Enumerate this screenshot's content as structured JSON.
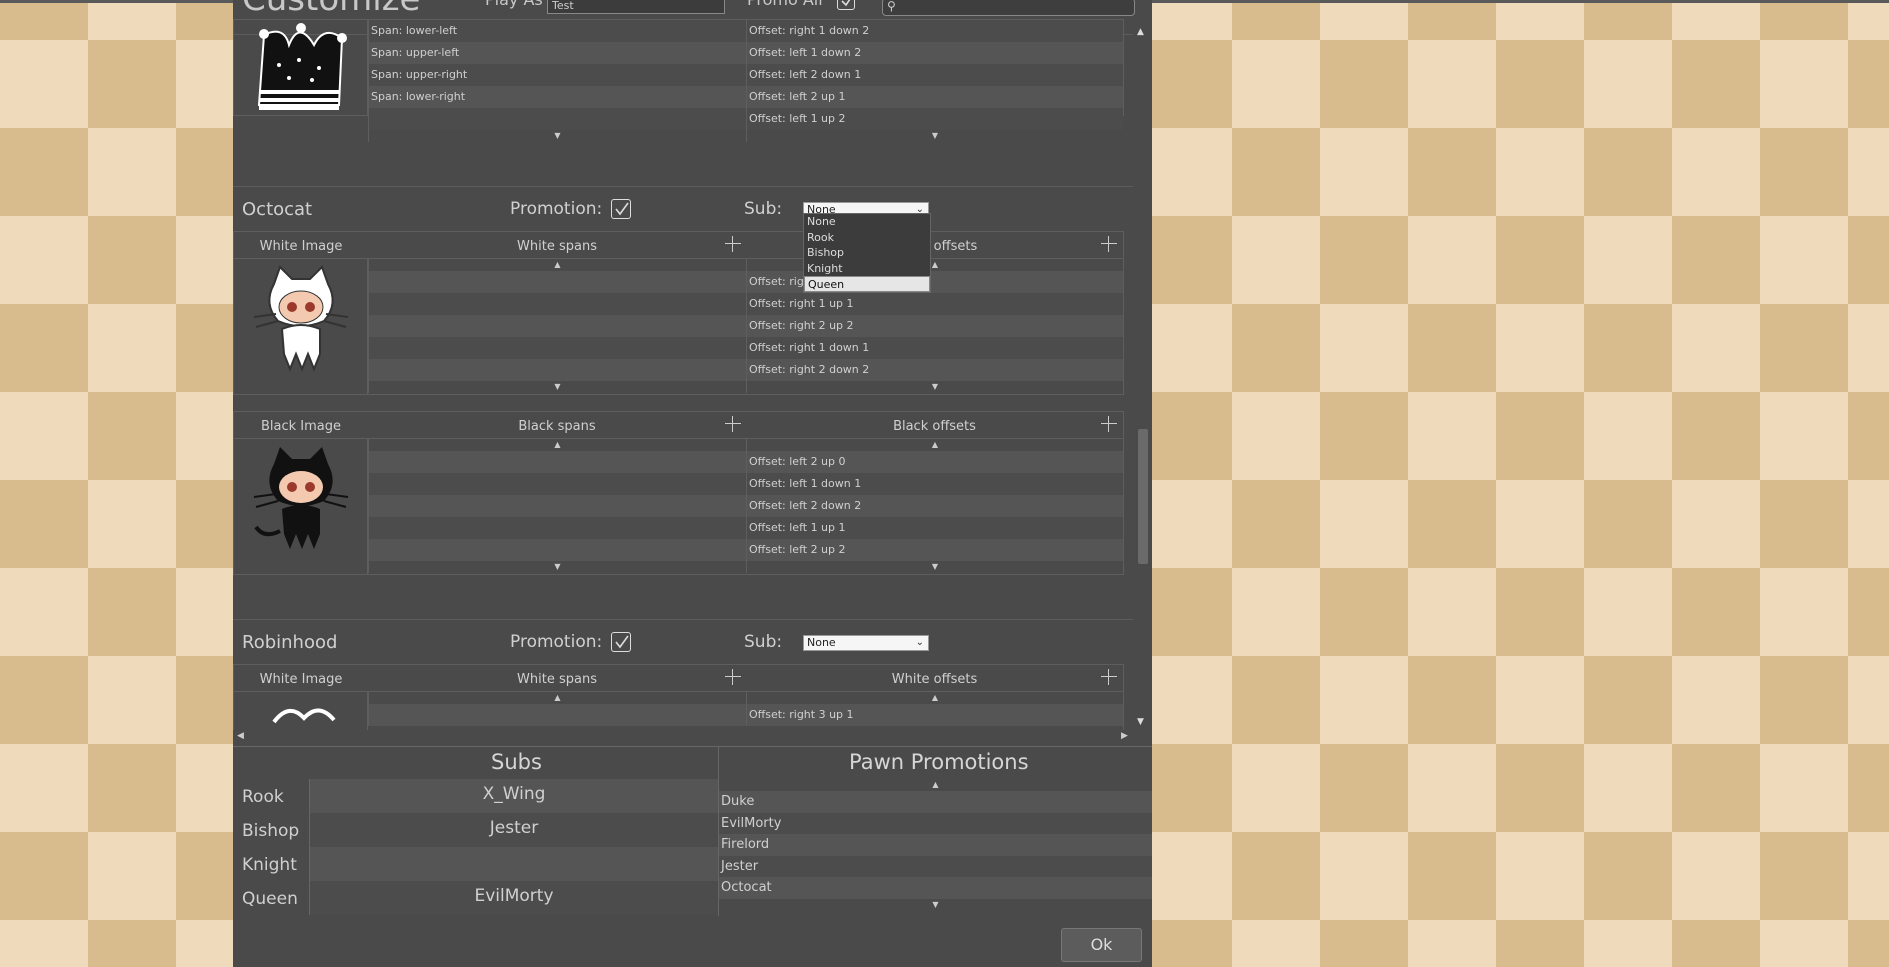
{
  "header": {
    "title": "Customize",
    "play_as_label": "Play As",
    "play_as_value": "Test",
    "promo_all_label": "Promo All"
  },
  "jester_block": {
    "spans": [
      "Span: lower-left",
      "Span: upper-left",
      "Span: upper-right",
      "Span: lower-right",
      ""
    ],
    "offsets": [
      "Offset: right 1 down 2",
      "Offset: left 1 down 2",
      "Offset: left 2 down 1",
      "Offset: left 2 up 1",
      "Offset: left 1 up 2"
    ]
  },
  "octocat": {
    "name": "Octocat",
    "promotion_label": "Promotion:",
    "sub_label": "Sub:",
    "sub_value": "None",
    "white_image_label": "White Image",
    "white_spans_label": "White spans",
    "white_offsets_label": "White offsets",
    "white_offsets": [
      "Offset: right",
      "Offset: right 1 up 1",
      "Offset: right 2 up 2",
      "Offset: right 1 down 1",
      "Offset: right 2 down 2"
    ],
    "black_image_label": "Black Image",
    "black_spans_label": "Black spans",
    "black_offsets_label": "Black offsets",
    "black_offsets": [
      "Offset: left 2 up 0",
      "Offset: left 1 down 1",
      "Offset: left 2 down 2",
      "Offset: left 1 up 1",
      "Offset: left 2 up 2"
    ]
  },
  "sub_dropdown": {
    "options": [
      "None",
      "Rook",
      "Bishop",
      "Knight",
      "Queen"
    ],
    "highlighted": "Queen"
  },
  "robinhood": {
    "name": "Robinhood",
    "promotion_label": "Promotion:",
    "sub_label": "Sub:",
    "sub_value": "None",
    "white_image_label": "White Image",
    "white_spans_label": "White spans",
    "white_offsets_label": "White offsets",
    "white_offsets": [
      "Offset: right 3 up 1"
    ]
  },
  "subs_panel": {
    "title": "Subs",
    "rows": [
      {
        "key": "Rook",
        "value": "X_Wing"
      },
      {
        "key": "Bishop",
        "value": "Jester"
      },
      {
        "key": "Knight",
        "value": ""
      },
      {
        "key": "Queen",
        "value": "EvilMorty"
      }
    ]
  },
  "promotions_panel": {
    "title": "Pawn Promotions",
    "items": [
      "Duke",
      "EvilMorty",
      "Firelord",
      "Jester",
      "Octocat"
    ]
  },
  "ok_label": "Ok"
}
